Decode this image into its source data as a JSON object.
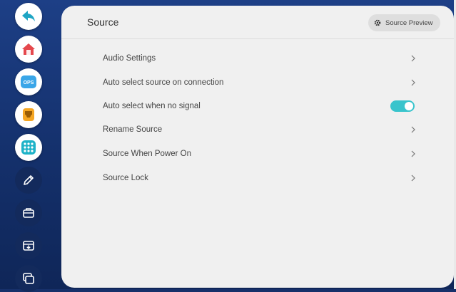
{
  "panel": {
    "title": "Source",
    "preview_button_label": "Source Preview"
  },
  "menu": {
    "items": [
      {
        "label": "Audio Settings",
        "control": "chevron"
      },
      {
        "label": "Auto select source on connection",
        "control": "chevron"
      },
      {
        "label": "Auto select when no signal",
        "control": "toggle",
        "toggle_on": true
      },
      {
        "label": "Rename Source",
        "control": "chevron"
      },
      {
        "label": "Source When Power On",
        "control": "chevron"
      },
      {
        "label": "Source Lock",
        "control": "chevron"
      }
    ]
  },
  "sidebar": {
    "items": [
      {
        "icon": "back-arrow-icon",
        "icon_text": ""
      },
      {
        "icon": "home-icon",
        "icon_text": ""
      },
      {
        "icon": "ops-icon",
        "icon_text": "OPS"
      },
      {
        "icon": "hdmi-port-icon",
        "icon_text": ""
      },
      {
        "icon": "apps-grid-icon",
        "icon_text": ""
      },
      {
        "icon": "pen-icon",
        "icon_text": ""
      },
      {
        "icon": "toolbox-icon",
        "icon_text": ""
      },
      {
        "icon": "screen-capture-icon",
        "icon_text": ""
      },
      {
        "icon": "multi-window-icon",
        "icon_text": ""
      }
    ]
  },
  "colors": {
    "accent": "#39c4cc",
    "desktop_bg": "#17306a",
    "panel_bg": "#f0f0f0",
    "home_red": "#e5484d",
    "ops_blue": "#3aa6e8",
    "hdmi_orange": "#f5a623",
    "apps_teal": "#1fb3c8"
  }
}
